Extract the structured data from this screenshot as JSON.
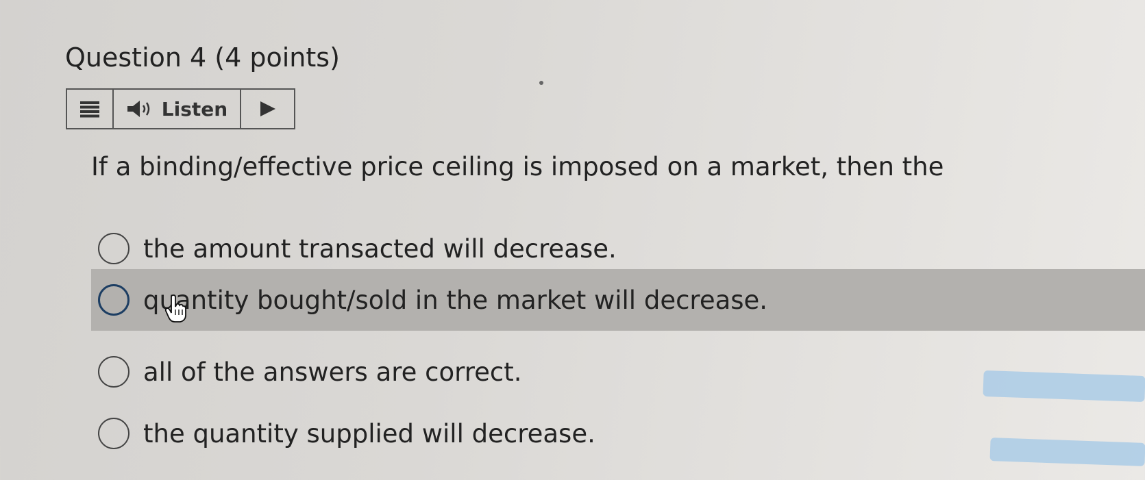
{
  "question": {
    "title": "Question 4 (4 points)",
    "prompt": "If a binding/effective price ceiling is imposed on a market, then the"
  },
  "toolbar": {
    "menu_icon": "menu-icon",
    "speaker_icon": "speaker-icon",
    "listen_label": "Listen",
    "play_icon": "play-icon"
  },
  "options": [
    {
      "label": "the amount transacted will decrease.",
      "highlighted": false
    },
    {
      "label": "quantity bought/sold in the market will decrease.",
      "highlighted": true
    },
    {
      "label": "all of the answers are correct.",
      "highlighted": false
    },
    {
      "label": "the quantity supplied will decrease.",
      "highlighted": false
    }
  ],
  "colors": {
    "highlight_row": "#b3b1ae",
    "focused_radio_border": "#1d3e63",
    "text": "#222222"
  }
}
